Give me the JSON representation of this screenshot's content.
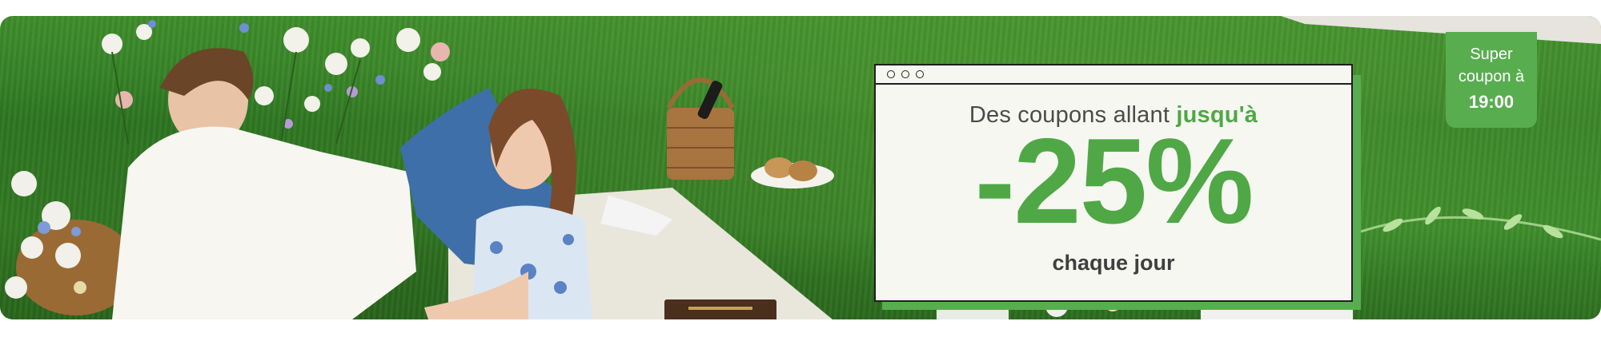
{
  "banner": {
    "coupon": {
      "line1_prefix": "Des coupons allant",
      "line1_accent": "jusqu'à",
      "discount": "-25%",
      "line3": "chaque jour"
    },
    "badge": {
      "line1": "Super",
      "line2": "coupon à",
      "time": "19:00"
    }
  },
  "colors": {
    "accent": "#4fa845",
    "badge_bg": "#58ae4f",
    "window_bg": "#f7f7f2",
    "text_dark": "#3f3f3f"
  }
}
